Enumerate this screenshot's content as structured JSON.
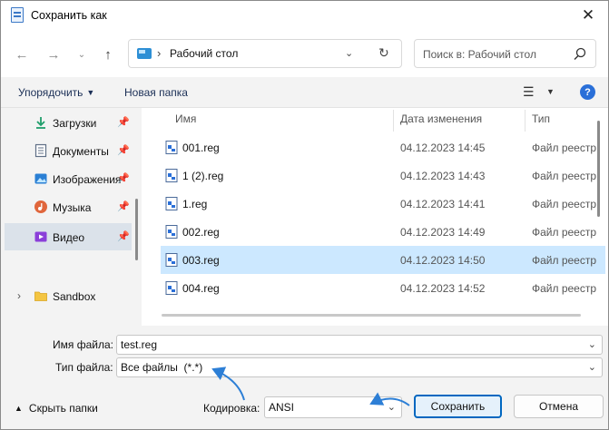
{
  "window": {
    "title": "Сохранить как"
  },
  "nav": {
    "address_path": "Рабочий стол",
    "search_placeholder": "Поиск в: Рабочий стол"
  },
  "toolbar": {
    "organize_label": "Упорядочить",
    "new_folder_label": "Новая папка"
  },
  "sidebar": {
    "items": [
      {
        "label": "Загрузки",
        "icon": "download-icon",
        "pinned": true
      },
      {
        "label": "Документы",
        "icon": "documents-icon",
        "pinned": true
      },
      {
        "label": "Изображения",
        "icon": "pictures-icon",
        "pinned": true
      },
      {
        "label": "Музыка",
        "icon": "music-icon",
        "pinned": true
      },
      {
        "label": "Видео",
        "icon": "video-icon",
        "pinned": true,
        "selected": true
      },
      {
        "label": "Sandbox",
        "icon": "folder-icon",
        "expandable": true
      }
    ]
  },
  "columns": {
    "name": "Имя",
    "date": "Дата изменения",
    "type": "Тип"
  },
  "files": [
    {
      "name": "001.reg",
      "date": "04.12.2023 14:45",
      "type": "Файл реестр"
    },
    {
      "name": "1 (2).reg",
      "date": "04.12.2023 14:43",
      "type": "Файл реестр"
    },
    {
      "name": "1.reg",
      "date": "04.12.2023 14:41",
      "type": "Файл реестр"
    },
    {
      "name": "002.reg",
      "date": "04.12.2023 14:49",
      "type": "Файл реестр"
    },
    {
      "name": "003.reg",
      "date": "04.12.2023 14:50",
      "type": "Файл реестр",
      "selected": true
    },
    {
      "name": "004.reg",
      "date": "04.12.2023 14:52",
      "type": "Файл реестр"
    }
  ],
  "form": {
    "filename_label": "Имя файла:",
    "filename_value": "test.reg",
    "filetype_label": "Тип файла:",
    "filetype_value": "Все файлы  (*.*)",
    "encoding_label": "Кодировка:",
    "encoding_value": "ANSI",
    "hide_folders_label": "Скрыть папки",
    "save_label": "Сохранить",
    "cancel_label": "Отмена"
  },
  "colors": {
    "accent": "#0067c0",
    "selection": "#cce8ff",
    "annotation_arrow": "#2d7fd6"
  }
}
